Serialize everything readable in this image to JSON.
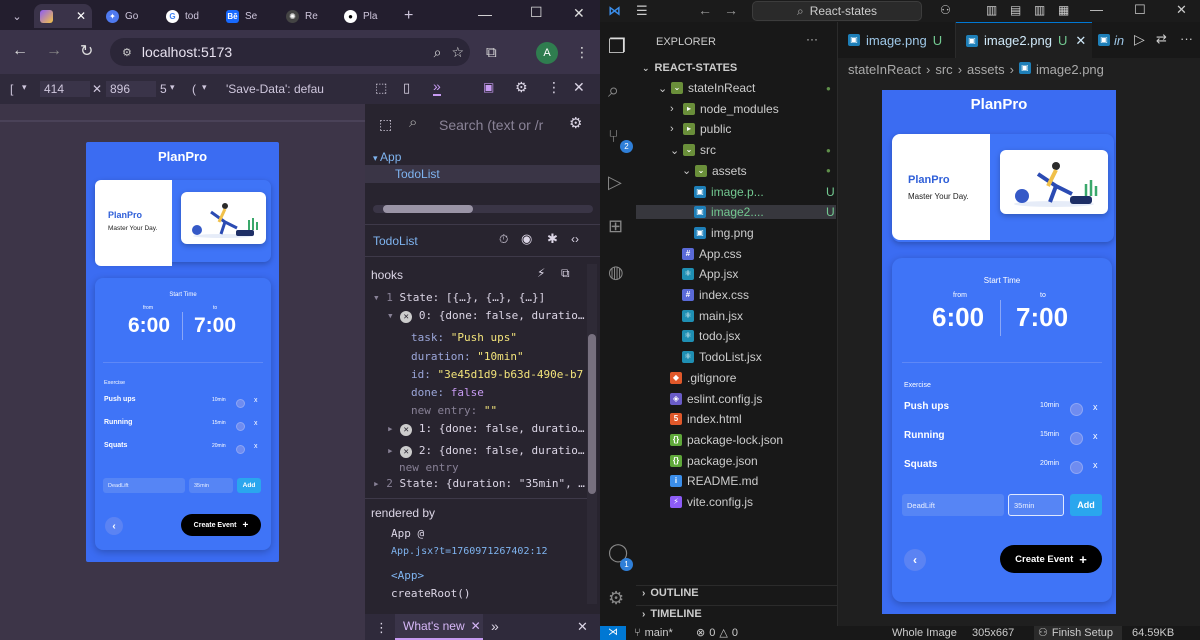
{
  "chrome": {
    "tabs": [
      {
        "label": "",
        "icon": "vite-icon"
      },
      {
        "label": "Go",
        "icon": "gemini-icon"
      },
      {
        "label": "tod",
        "icon": "google-icon"
      },
      {
        "label": "Se",
        "icon": "behance-icon"
      },
      {
        "label": "Re",
        "icon": "openai-icon"
      },
      {
        "label": "Pla",
        "icon": "github-icon"
      }
    ],
    "new_tab": "+",
    "url": "localhost:5173",
    "avatar_letter": "A",
    "devbar": {
      "device": "[",
      "width": "414",
      "height": "896",
      "zoom": "5",
      "throttle": "(",
      "save_data": "'Save-Data': defau"
    }
  },
  "app": {
    "title": "PlanPro",
    "card_brand": "PlanPro",
    "card_tagline": "Master Your Day.",
    "start_time_label": "Start Time",
    "from_label": "from",
    "to_label": "to",
    "from_time": "6:00",
    "to_time": "7:00",
    "exercise_label": "Exercise",
    "tasks": [
      {
        "name": "Push ups",
        "duration": "10min",
        "remove": "x"
      },
      {
        "name": "Running",
        "duration": "15min",
        "remove": "x"
      },
      {
        "name": "Squats",
        "duration": "20min",
        "remove": "x"
      }
    ],
    "task_input": "DeadLift",
    "duration_input": "35min",
    "add_label": "Add",
    "back_label": "‹",
    "create_label": "Create Event",
    "create_plus": "+"
  },
  "devtools": {
    "search_placeholder": "Search (text or /r",
    "tree_root": "App",
    "tree_child": "TodoList",
    "selected_component": "TodoList",
    "hooks_label": "hooks",
    "state1": "State: [{…}, {…}, {…}]",
    "item0": "0: {done: false, duratio…",
    "task_key": "task:",
    "task_val": "\"Push ups\"",
    "duration_key": "duration:",
    "duration_val": "\"10min\"",
    "id_key": "id:",
    "id_val": "\"3e45d1d9-b63d-490e-b7",
    "done_key": "done:",
    "done_val": "false",
    "new_entry_key": "new entry:",
    "new_entry_val": "\"\"",
    "item1": "1: {done: false, duratio…",
    "item2": "2: {done: false, duratio…",
    "new_entry": "new entry",
    "state2": "State: {duration: \"35min\", …",
    "rendered_by": "rendered by",
    "app_at": "App @",
    "app_link": "App.jsx?t=1760971267402:12",
    "app_tag": "<App>",
    "create_root": "createRoot()",
    "bottom_tab": "What's new",
    "num1": "1",
    "num2": "2"
  },
  "vscode": {
    "search": "React-states",
    "explorer_title": "EXPLORER",
    "project": "REACT-STATES",
    "tree": [
      {
        "label": "stateInReact",
        "indent": 1,
        "type": "folder-open",
        "mark": "dot"
      },
      {
        "label": "node_modules",
        "indent": 2,
        "type": "folder",
        "mark": ""
      },
      {
        "label": "public",
        "indent": 2,
        "type": "folder",
        "mark": ""
      },
      {
        "label": "src",
        "indent": 2,
        "type": "folder-open",
        "mark": "dot"
      },
      {
        "label": "assets",
        "indent": 3,
        "type": "folder-open",
        "mark": "dot"
      },
      {
        "label": "image.p...",
        "indent": 4,
        "type": "image",
        "mark": "U"
      },
      {
        "label": "image2....",
        "indent": 4,
        "type": "image",
        "mark": "U"
      },
      {
        "label": "img.png",
        "indent": 4,
        "type": "image",
        "mark": ""
      },
      {
        "label": "App.css",
        "indent": 3,
        "type": "css",
        "mark": ""
      },
      {
        "label": "App.jsx",
        "indent": 3,
        "type": "react",
        "mark": ""
      },
      {
        "label": "index.css",
        "indent": 3,
        "type": "css",
        "mark": ""
      },
      {
        "label": "main.jsx",
        "indent": 3,
        "type": "react",
        "mark": ""
      },
      {
        "label": "todo.jsx",
        "indent": 3,
        "type": "react",
        "mark": ""
      },
      {
        "label": "TodoList.jsx",
        "indent": 3,
        "type": "react",
        "mark": ""
      },
      {
        "label": ".gitignore",
        "indent": 2,
        "type": "git",
        "mark": ""
      },
      {
        "label": "eslint.config.js",
        "indent": 2,
        "type": "eslint",
        "mark": ""
      },
      {
        "label": "index.html",
        "indent": 2,
        "type": "html",
        "mark": ""
      },
      {
        "label": "package-lock.json",
        "indent": 2,
        "type": "json",
        "mark": ""
      },
      {
        "label": "package.json",
        "indent": 2,
        "type": "json",
        "mark": ""
      },
      {
        "label": "README.md",
        "indent": 2,
        "type": "info",
        "mark": ""
      },
      {
        "label": "vite.config.js",
        "indent": 2,
        "type": "vite",
        "mark": ""
      }
    ],
    "tabs": [
      {
        "label": "image.png",
        "mark": "U"
      },
      {
        "label": "image2.png",
        "mark": "U"
      },
      {
        "label": "in",
        "mark": ""
      }
    ],
    "breadcrumb": [
      "stateInReact",
      "src",
      "assets",
      "image2.png"
    ],
    "outline": "OUTLINE",
    "timeline": "TIMELINE",
    "scm_badge": "2",
    "account_badge": "1",
    "status": {
      "branch": "main*",
      "errors": "0",
      "warnings": "0",
      "image_mode": "Whole Image",
      "dims": "305x667",
      "setup": "Finish Setup",
      "size": "64.59KB"
    }
  }
}
